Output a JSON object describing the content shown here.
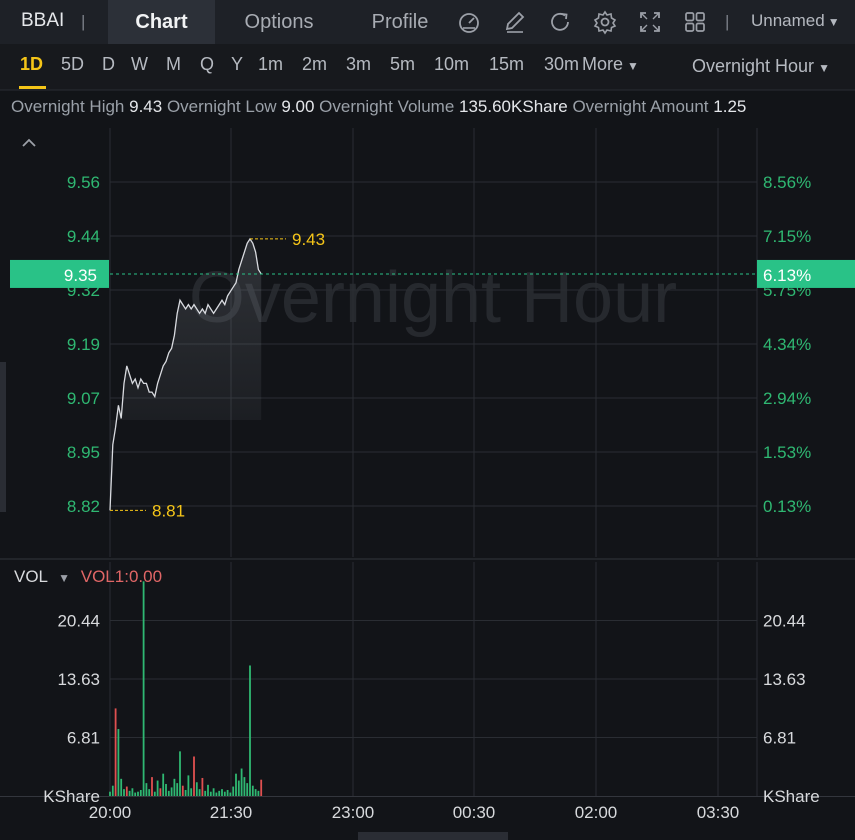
{
  "header": {
    "ticker": "BBAI",
    "tabs": [
      {
        "label": "Chart",
        "active": true
      },
      {
        "label": "Options",
        "active": false
      },
      {
        "label": "Profile",
        "active": false
      }
    ],
    "icons": [
      "indicator-gauge-icon",
      "draw-pen-icon",
      "refresh-icon",
      "settings-gear-icon",
      "fullscreen-icon",
      "layout-grid-icon"
    ],
    "layout_name": "Unnamed"
  },
  "periods": {
    "items": [
      "1D",
      "5D",
      "D",
      "W",
      "M",
      "Q",
      "Y",
      "1m",
      "2m",
      "3m",
      "5m",
      "10m",
      "15m",
      "30m"
    ],
    "active": "1D",
    "more_label": "More",
    "session_label": "Overnight Hour"
  },
  "stats": [
    {
      "label": "Overnight High",
      "value": "9.43"
    },
    {
      "label": "Overnight Low",
      "value": "9.00"
    },
    {
      "label": "Overnight Volume",
      "value": "135.60KShare"
    },
    {
      "label": "Overnight Amount",
      "value": "1.25"
    }
  ],
  "watermark": "Overnight Hour",
  "chart_data": {
    "type": "line",
    "x_ticks": [
      "20:00",
      "21:30",
      "23:00",
      "00:30",
      "02:00",
      "03:30"
    ],
    "y_ticks_left": [
      "9.56",
      "9.44",
      "9.32",
      "9.19",
      "9.07",
      "8.95",
      "8.82"
    ],
    "y_ticks_right": [
      "8.56%",
      "7.15%",
      "5.75%",
      "4.34%",
      "2.94%",
      "1.53%",
      "0.13%"
    ],
    "ylim": [
      8.82,
      9.56
    ],
    "current_price": "9.35",
    "current_change": "6.13%",
    "high_label": "9.43",
    "low_label": "8.81",
    "price_series": [
      {
        "t": 0,
        "p": 8.81
      },
      {
        "t": 1,
        "p": 8.96
      },
      {
        "t": 2,
        "p": 9.0
      },
      {
        "t": 3,
        "p": 9.05
      },
      {
        "t": 4,
        "p": 9.02
      },
      {
        "t": 5,
        "p": 9.1
      },
      {
        "t": 6,
        "p": 9.14
      },
      {
        "t": 7,
        "p": 9.12
      },
      {
        "t": 8,
        "p": 9.1
      },
      {
        "t": 9,
        "p": 9.11
      },
      {
        "t": 10,
        "p": 9.09
      },
      {
        "t": 11,
        "p": 9.11
      },
      {
        "t": 12,
        "p": 9.1
      },
      {
        "t": 13,
        "p": 9.1
      },
      {
        "t": 14,
        "p": 9.08
      },
      {
        "t": 15,
        "p": 9.08
      },
      {
        "t": 16,
        "p": 9.07
      },
      {
        "t": 17,
        "p": 9.1
      },
      {
        "t": 18,
        "p": 9.12
      },
      {
        "t": 19,
        "p": 9.14
      },
      {
        "t": 20,
        "p": 9.15
      },
      {
        "t": 21,
        "p": 9.17
      },
      {
        "t": 22,
        "p": 9.18
      },
      {
        "t": 23,
        "p": 9.21
      },
      {
        "t": 24,
        "p": 9.26
      },
      {
        "t": 25,
        "p": 9.29
      },
      {
        "t": 26,
        "p": 9.28
      },
      {
        "t": 27,
        "p": 9.27
      },
      {
        "t": 28,
        "p": 9.28
      },
      {
        "t": 29,
        "p": 9.27
      },
      {
        "t": 30,
        "p": 9.28
      },
      {
        "t": 31,
        "p": 9.27
      },
      {
        "t": 32,
        "p": 9.26
      },
      {
        "t": 33,
        "p": 9.27
      },
      {
        "t": 34,
        "p": 9.26
      },
      {
        "t": 35,
        "p": 9.28
      },
      {
        "t": 36,
        "p": 9.27
      },
      {
        "t": 37,
        "p": 9.26
      },
      {
        "t": 38,
        "p": 9.27
      },
      {
        "t": 39,
        "p": 9.28
      },
      {
        "t": 40,
        "p": 9.29
      },
      {
        "t": 41,
        "p": 9.28
      },
      {
        "t": 42,
        "p": 9.3
      },
      {
        "t": 43,
        "p": 9.31
      },
      {
        "t": 44,
        "p": 9.32
      },
      {
        "t": 45,
        "p": 9.33
      },
      {
        "t": 46,
        "p": 9.36
      },
      {
        "t": 47,
        "p": 9.38
      },
      {
        "t": 48,
        "p": 9.4
      },
      {
        "t": 49,
        "p": 9.42
      },
      {
        "t": 50,
        "p": 9.43
      },
      {
        "t": 51,
        "p": 9.42
      },
      {
        "t": 52,
        "p": 9.4
      },
      {
        "t": 53,
        "p": 9.36
      },
      {
        "t": 54,
        "p": 9.35
      }
    ],
    "volume": {
      "label": "VOL",
      "indicator_label": "VOL1:0.00",
      "y_ticks": [
        "20.44",
        "13.63",
        "6.81"
      ],
      "unit": "KShare",
      "ylim": [
        0,
        27.25
      ],
      "bars": [
        {
          "t": 0,
          "v": 0.5,
          "up": true
        },
        {
          "t": 1,
          "v": 1.2,
          "up": true
        },
        {
          "t": 2,
          "v": 10.2,
          "up": false
        },
        {
          "t": 3,
          "v": 7.8,
          "up": true
        },
        {
          "t": 4,
          "v": 2.0,
          "up": true
        },
        {
          "t": 5,
          "v": 0.8,
          "up": true
        },
        {
          "t": 6,
          "v": 1.1,
          "up": false
        },
        {
          "t": 7,
          "v": 0.6,
          "up": true
        },
        {
          "t": 8,
          "v": 0.9,
          "up": true
        },
        {
          "t": 9,
          "v": 0.4,
          "up": true
        },
        {
          "t": 10,
          "v": 0.5,
          "up": true
        },
        {
          "t": 11,
          "v": 0.7,
          "up": true
        },
        {
          "t": 12,
          "v": 25.0,
          "up": true
        },
        {
          "t": 13,
          "v": 1.5,
          "up": true
        },
        {
          "t": 14,
          "v": 0.8,
          "up": true
        },
        {
          "t": 15,
          "v": 2.2,
          "up": false
        },
        {
          "t": 16,
          "v": 0.5,
          "up": true
        },
        {
          "t": 17,
          "v": 1.8,
          "up": true
        },
        {
          "t": 18,
          "v": 0.9,
          "up": false
        },
        {
          "t": 19,
          "v": 2.6,
          "up": true
        },
        {
          "t": 20,
          "v": 1.4,
          "up": true
        },
        {
          "t": 21,
          "v": 0.6,
          "up": true
        },
        {
          "t": 22,
          "v": 1.0,
          "up": true
        },
        {
          "t": 23,
          "v": 2.0,
          "up": true
        },
        {
          "t": 24,
          "v": 1.5,
          "up": true
        },
        {
          "t": 25,
          "v": 5.2,
          "up": true
        },
        {
          "t": 26,
          "v": 1.2,
          "up": false
        },
        {
          "t": 27,
          "v": 0.7,
          "up": true
        },
        {
          "t": 28,
          "v": 2.4,
          "up": true
        },
        {
          "t": 29,
          "v": 0.9,
          "up": true
        },
        {
          "t": 30,
          "v": 4.6,
          "up": false
        },
        {
          "t": 31,
          "v": 1.6,
          "up": true
        },
        {
          "t": 32,
          "v": 0.8,
          "up": true
        },
        {
          "t": 33,
          "v": 2.1,
          "up": false
        },
        {
          "t": 34,
          "v": 0.6,
          "up": true
        },
        {
          "t": 35,
          "v": 1.3,
          "up": true
        },
        {
          "t": 36,
          "v": 0.5,
          "up": true
        },
        {
          "t": 37,
          "v": 0.9,
          "up": true
        },
        {
          "t": 38,
          "v": 0.4,
          "up": true
        },
        {
          "t": 39,
          "v": 0.6,
          "up": true
        },
        {
          "t": 40,
          "v": 0.8,
          "up": true
        },
        {
          "t": 41,
          "v": 0.5,
          "up": true
        },
        {
          "t": 42,
          "v": 0.7,
          "up": true
        },
        {
          "t": 43,
          "v": 0.4,
          "up": true
        },
        {
          "t": 44,
          "v": 1.1,
          "up": true
        },
        {
          "t": 45,
          "v": 2.6,
          "up": true
        },
        {
          "t": 46,
          "v": 1.8,
          "up": true
        },
        {
          "t": 47,
          "v": 3.2,
          "up": true
        },
        {
          "t": 48,
          "v": 2.2,
          "up": true
        },
        {
          "t": 49,
          "v": 1.5,
          "up": true
        },
        {
          "t": 50,
          "v": 15.2,
          "up": true
        },
        {
          "t": 51,
          "v": 1.2,
          "up": true
        },
        {
          "t": 52,
          "v": 0.8,
          "up": true
        },
        {
          "t": 53,
          "v": 0.6,
          "up": true
        },
        {
          "t": 54,
          "v": 1.9,
          "up": false
        }
      ]
    },
    "colors": {
      "price_line": "#d9dbe0",
      "axis_green": "#2fb872",
      "current_bg": "#29c287",
      "marker_yellow": "#f5c518",
      "up_bar": "#2fb872",
      "down_bar": "#e05050",
      "grid": "#2a2d33"
    }
  }
}
